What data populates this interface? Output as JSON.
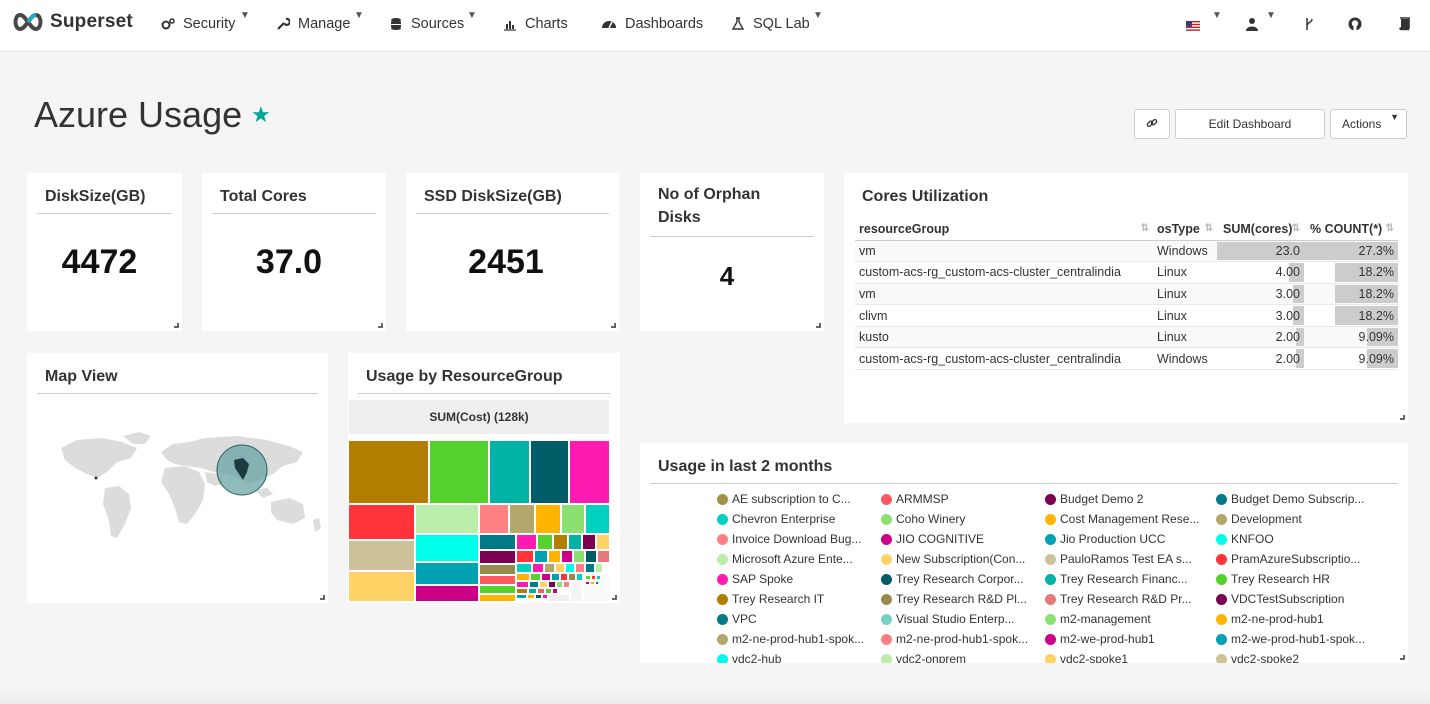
{
  "nav": {
    "brand": "Superset",
    "items": [
      {
        "label": "Security",
        "icon": "cogs-icon"
      },
      {
        "label": "Manage",
        "icon": "wrench-icon"
      },
      {
        "label": "Sources",
        "icon": "database-icon"
      },
      {
        "label": "Charts",
        "icon": "bar-chart-icon"
      },
      {
        "label": "Dashboards",
        "icon": "dashboard-icon"
      },
      {
        "label": "SQL Lab",
        "icon": "flask-icon"
      }
    ]
  },
  "dashboard": {
    "title": "Azure Usage",
    "favorite": true,
    "edit_label": "Edit Dashboard",
    "actions_label": "Actions"
  },
  "big_numbers": [
    {
      "title": "DiskSize(GB)",
      "value": "4472"
    },
    {
      "title": "Total Cores",
      "value": "37.0"
    },
    {
      "title": "SSD DiskSize(GB)",
      "value": "2451"
    },
    {
      "title_line1": "No of Orphan",
      "title_line2": "Disks",
      "value": "4"
    }
  ],
  "cores_utilization": {
    "title": "Cores Utilization",
    "columns": [
      "resourceGroup",
      "osType",
      "SUM(cores)",
      "% COUNT(*)"
    ],
    "rows": [
      {
        "resourceGroup": "vm",
        "osType": "Windows",
        "sum_cores": "23.0",
        "pct": "27.3%",
        "sum_frac": 1.0,
        "pct_frac": 1.0
      },
      {
        "resourceGroup": "custom-acs-rg_custom-acs-cluster_centralindia",
        "osType": "Linux",
        "sum_cores": "4.00",
        "pct": "18.2%",
        "sum_frac": 0.174,
        "pct_frac": 0.667
      },
      {
        "resourceGroup": "vm",
        "osType": "Linux",
        "sum_cores": "3.00",
        "pct": "18.2%",
        "sum_frac": 0.13,
        "pct_frac": 0.667
      },
      {
        "resourceGroup": "clivm",
        "osType": "Linux",
        "sum_cores": "3.00",
        "pct": "18.2%",
        "sum_frac": 0.13,
        "pct_frac": 0.667
      },
      {
        "resourceGroup": "kusto",
        "osType": "Linux",
        "sum_cores": "2.00",
        "pct": "9.09%",
        "sum_frac": 0.087,
        "pct_frac": 0.333
      },
      {
        "resourceGroup": "custom-acs-rg_custom-acs-cluster_centralindia",
        "osType": "Windows",
        "sum_cores": "2.00",
        "pct": "9.09%",
        "sum_frac": 0.087,
        "pct_frac": 0.333
      }
    ]
  },
  "map_view": {
    "title": "Map View"
  },
  "treemap": {
    "title": "Usage by ResourceGroup",
    "header": "SUM(Cost) (128k)"
  },
  "usage_months": {
    "title": "Usage in last 2 months",
    "legend": [
      {
        "label": "AE subscription to C...",
        "color": "#a09247"
      },
      {
        "label": "ARMMSP",
        "color": "#ff5a5f"
      },
      {
        "label": "Budget Demo 2",
        "color": "#7b0051"
      },
      {
        "label": "Budget Demo Subscrip...",
        "color": "#007a87"
      },
      {
        "label": "Chevron Enterprise",
        "color": "#00d1c1"
      },
      {
        "label": "Coho Winery",
        "color": "#8ce071"
      },
      {
        "label": "Cost Management Rese...",
        "color": "#ffb400"
      },
      {
        "label": "Development",
        "color": "#b4a76c"
      },
      {
        "label": "Invoice Download Bug...",
        "color": "#ff8083"
      },
      {
        "label": "JIO COGNITIVE",
        "color": "#cc0086"
      },
      {
        "label": "Jio Production UCC",
        "color": "#00a1b3"
      },
      {
        "label": "KNFOO",
        "color": "#00ffeb"
      },
      {
        "label": "Microsoft Azure Ente...",
        "color": "#bbedab"
      },
      {
        "label": "New Subscription(Con...",
        "color": "#ffd266"
      },
      {
        "label": "PauloRamos Test EA s...",
        "color": "#cbc29a"
      },
      {
        "label": "PramAzureSubscriptio...",
        "color": "#ff3339"
      },
      {
        "label": "SAP Spoke",
        "color": "#ff1ab1"
      },
      {
        "label": "Trey Research Corpor...",
        "color": "#005c66"
      },
      {
        "label": "Trey Research Financ...",
        "color": "#00b3a5"
      },
      {
        "label": "Trey Research HR",
        "color": "#55d12e"
      },
      {
        "label": "Trey Research IT",
        "color": "#b37e00"
      },
      {
        "label": "Trey Research R&D Pl...",
        "color": "#988b4e"
      },
      {
        "label": "Trey Research R&D Pr...",
        "color": "#e7787b"
      },
      {
        "label": "VDCTestSubscription",
        "color": "#7b0051"
      },
      {
        "label": "VPC",
        "color": "#007a87"
      },
      {
        "label": "Visual Studio Enterp...",
        "color": "#79d0c4"
      },
      {
        "label": "m2-management",
        "color": "#8ce071"
      },
      {
        "label": "m2-ne-prod-hub1",
        "color": "#ffb400"
      },
      {
        "label": "m2-ne-prod-hub1-spok...",
        "color": "#b4a76c"
      },
      {
        "label": "m2-ne-prod-hub1-spok...",
        "color": "#ff8083"
      },
      {
        "label": "m2-we-prod-hub1",
        "color": "#cc0086"
      },
      {
        "label": "m2-we-prod-hub1-spok...",
        "color": "#00a1b3"
      },
      {
        "label": "vdc2-hub",
        "color": "#00ffeb"
      },
      {
        "label": "vdc2-onprem",
        "color": "#bbedab"
      },
      {
        "label": "vdc2-spoke1",
        "color": "#ffd266"
      },
      {
        "label": "vdc2-spoke2",
        "color": "#cbc29a"
      }
    ]
  },
  "colors": {
    "accent": "#00a699",
    "bar": "#cccccc"
  }
}
